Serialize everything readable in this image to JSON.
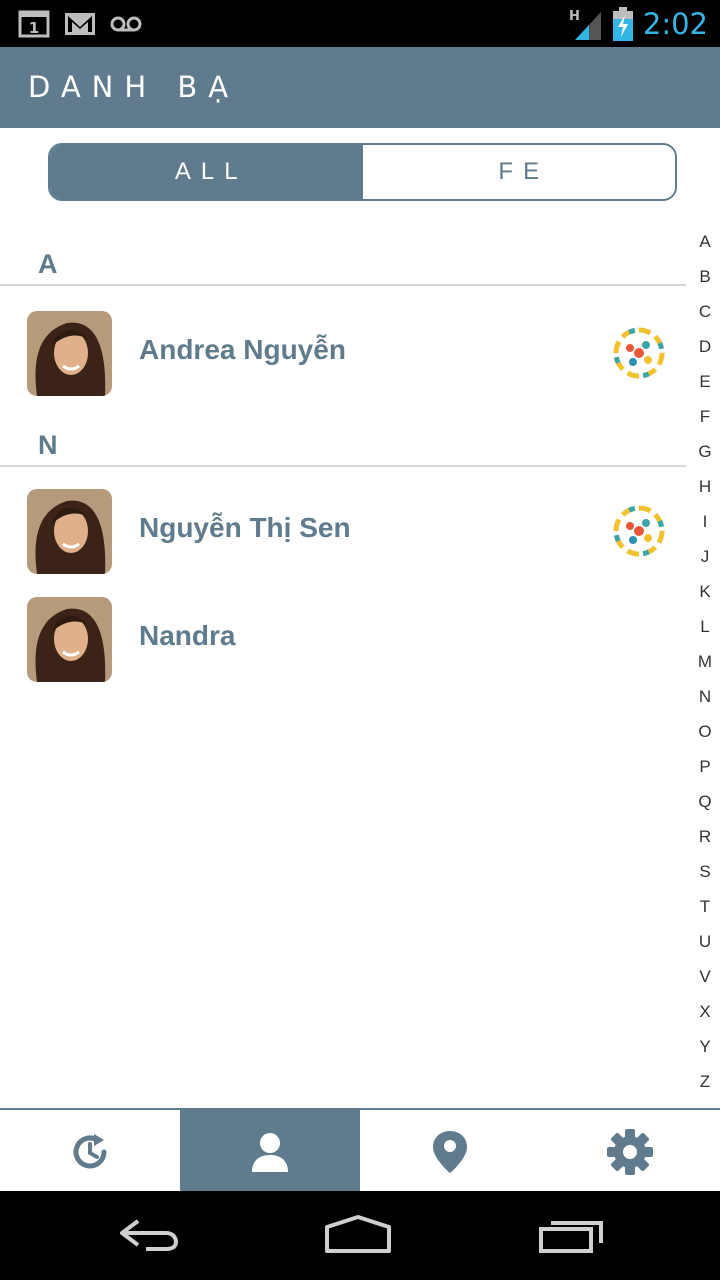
{
  "status_bar": {
    "time": "2:02",
    "network_label": "H",
    "notification_count": "1"
  },
  "header": {
    "title": "DANH BẠ"
  },
  "segmented": {
    "tabs": [
      {
        "label": "ALL",
        "active": true
      },
      {
        "label": "FE",
        "active": false
      }
    ]
  },
  "contacts": {
    "sections": [
      {
        "letter": "A",
        "items": [
          {
            "name": "Andrea Nguyễn",
            "has_badge": true
          }
        ]
      },
      {
        "letter": "N",
        "items": [
          {
            "name": "Nguyễn Thị Sen",
            "has_badge": true
          },
          {
            "name": "Nandra",
            "has_badge": false
          }
        ]
      }
    ]
  },
  "alphabet_index": [
    "A",
    "B",
    "C",
    "D",
    "E",
    "F",
    "G",
    "H",
    "I",
    "J",
    "K",
    "L",
    "M",
    "N",
    "O",
    "P",
    "Q",
    "R",
    "S",
    "T",
    "U",
    "V",
    "X",
    "Y",
    "Z"
  ],
  "bottom_tabs": [
    {
      "icon": "history-icon",
      "active": false
    },
    {
      "icon": "contacts-person-icon",
      "active": true
    },
    {
      "icon": "location-pin-icon",
      "active": false
    },
    {
      "icon": "settings-gear-icon",
      "active": false
    }
  ],
  "colors": {
    "primary": "#5f7b8d",
    "divider": "#d6d6d6",
    "clock": "#33b5e5"
  }
}
